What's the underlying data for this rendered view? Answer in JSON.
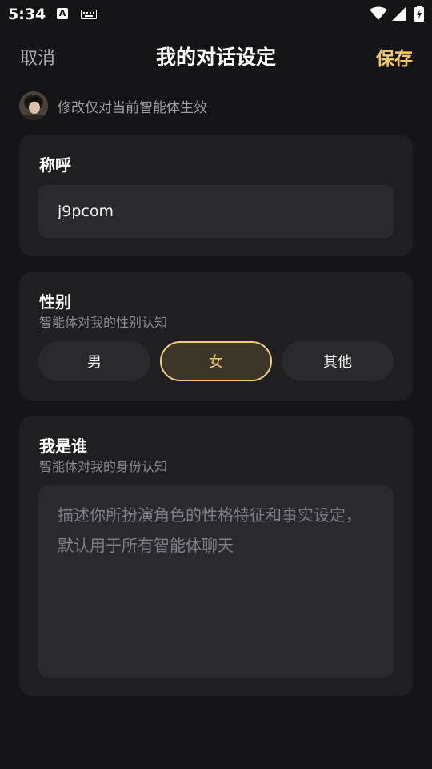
{
  "status_bar": {
    "time": "5:34",
    "a_badge": "A",
    "icons": [
      "a-notification-icon",
      "keyboard-icon",
      "wifi-icon",
      "signal-icon",
      "battery-charging-icon"
    ]
  },
  "header": {
    "cancel_label": "取消",
    "title": "我的对话设定",
    "save_label": "保存"
  },
  "notice": {
    "text": "修改仅对当前智能体生效"
  },
  "nickname_card": {
    "title": "称呼",
    "value": "j9pcom"
  },
  "gender_card": {
    "title": "性别",
    "subtitle": "智能体对我的性别认知",
    "options": [
      "男",
      "女",
      "其他"
    ],
    "selected": "女"
  },
  "identity_card": {
    "title": "我是谁",
    "subtitle": "智能体对我的身份认知",
    "value": "",
    "placeholder": "描述你所扮演角色的性格特征和事实设定，默认用于所有智能体聊天"
  },
  "colors": {
    "background": "#141416",
    "card": "#1f1f22",
    "field": "#2a2a2e",
    "accent": "#f3c968",
    "selected_border": "#f0cd82"
  }
}
